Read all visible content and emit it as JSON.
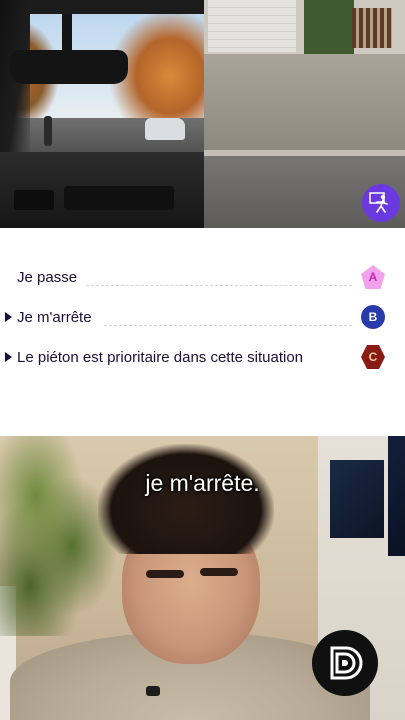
{
  "scene": {
    "left_view_icons": [
      "rearview-mirror-icon",
      "pedestrian-icon",
      "car-icon"
    ],
    "corner_icon": "pedestrian-crossing-icon"
  },
  "answers": [
    {
      "key": "A",
      "text": "Je passe",
      "arrow": false,
      "badge_shape": "pentagon",
      "badge_color": "#f2a2ea"
    },
    {
      "key": "B",
      "text": "Je m'arrête",
      "arrow": true,
      "badge_shape": "circle",
      "badge_color": "#2a3aa8"
    },
    {
      "key": "C",
      "text": "Le piéton est prioritaire dans cette situation",
      "arrow": true,
      "badge_shape": "hexagon",
      "badge_color": "#8a1a14"
    }
  ],
  "video": {
    "caption": "je m'arrête.",
    "logo_icon": "channel-logo-icon"
  },
  "colors": {
    "text": "#1b1035",
    "scene_icon_bg": "#6a3ae0"
  }
}
